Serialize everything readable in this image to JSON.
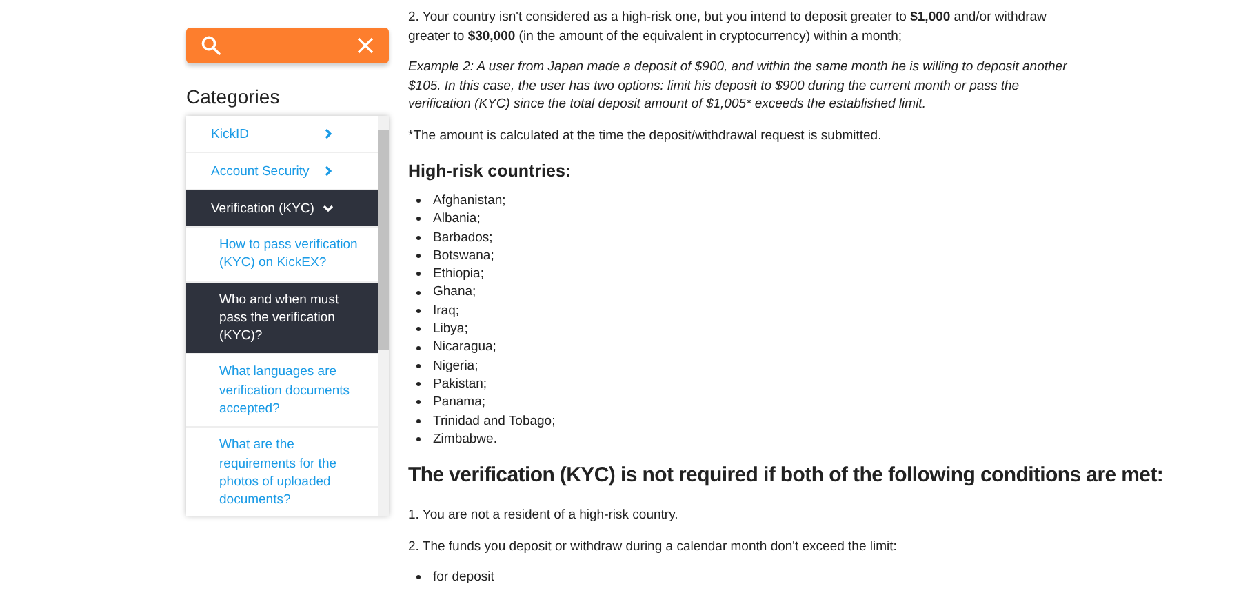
{
  "sidebar": {
    "title": "Categories",
    "categories": [
      {
        "label": "KickID",
        "selected": false,
        "expanded": false
      },
      {
        "label": "Account Security",
        "selected": false,
        "expanded": false
      },
      {
        "label": "Verification (KYC)",
        "selected": true,
        "expanded": true,
        "children": [
          {
            "label": "How to pass verification (KYC) on KickEX?",
            "selected": false
          },
          {
            "label": "Who and when must pass the verification (KYC)?",
            "selected": true
          },
          {
            "label": "What languages are verification documents accepted?",
            "selected": false
          },
          {
            "label": "What are the requirements for the photos of uploaded documents?",
            "selected": false
          }
        ]
      }
    ]
  },
  "article": [
    {
      "kind": "paragraph",
      "text": "2. Your country isn't considered as a high-risk one, but you intend to deposit greater to **$1,000** and/or withdraw greater to **$30,000** (in the amount of the equivalent in cryptocurrency) within a month;"
    },
    {
      "kind": "example",
      "text": "Example 2: A user from Japan made a deposit of $900, and within the same month he is willing to deposit another $105. In this case, the user has two options: limit his deposit to $900 during the current month or pass the verification (KYC) since the total deposit amount of $1,005* exceeds the established limit."
    },
    {
      "kind": "paragraph",
      "text": "*The amount is calculated at the time the deposit/withdrawal request is submitted."
    },
    {
      "kind": "subheading",
      "text": "High-risk countries:"
    },
    {
      "kind": "list",
      "items": [
        "Afghanistan;",
        "Albania;",
        "Barbados;",
        "Botswana;",
        "Ethiopia;",
        "Ghana;",
        "Iraq;",
        "Libya;",
        "Nicaragua;",
        "Nigeria;",
        "Pakistan;",
        "Panama;",
        "Trinidad and Tobago;",
        "Zimbabwe."
      ]
    },
    {
      "kind": "heading",
      "text": "The verification (KYC) is not required if both of the following conditions are met:"
    },
    {
      "kind": "paragraph",
      "text": "1. You are not a resident of a high-risk country."
    },
    {
      "kind": "paragraph",
      "text": "2. The funds you deposit or withdraw during a calendar month don't exceed the limit:"
    },
    {
      "kind": "list",
      "items": [
        "for deposit"
      ]
    }
  ]
}
